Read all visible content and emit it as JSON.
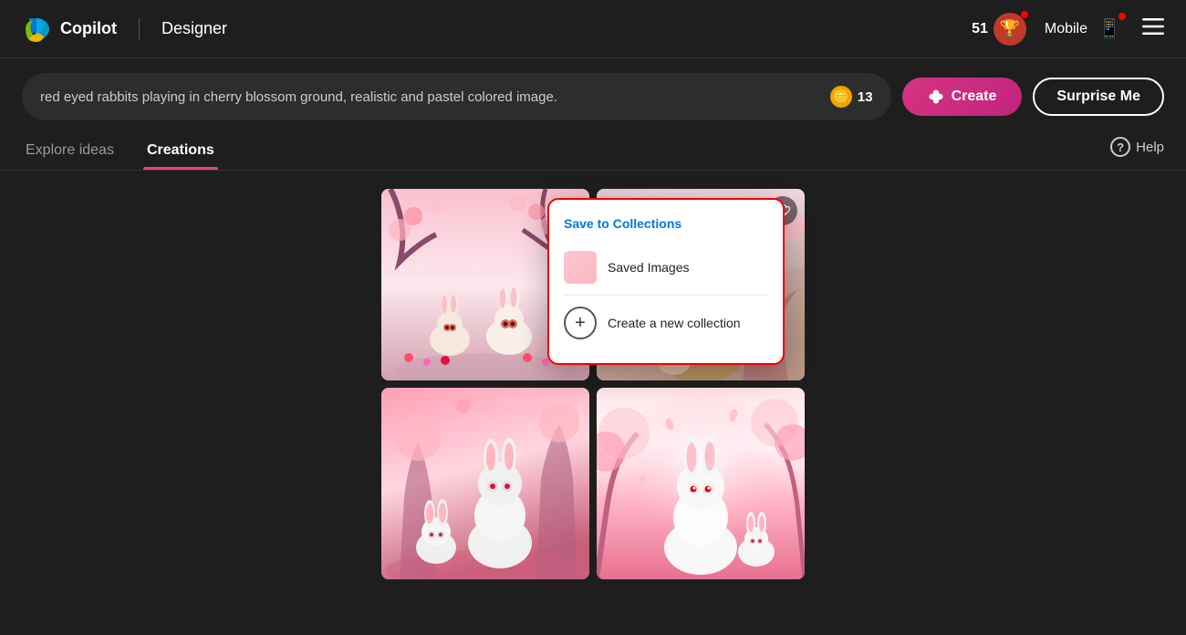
{
  "header": {
    "logo_text": "Copilot",
    "divider": "|",
    "app_name": "Designer",
    "coins": "51",
    "mobile_label": "Mobile",
    "hamburger_label": "☰"
  },
  "search": {
    "query": "red eyed rabbits playing in cherry blossom ground, realistic and pastel colored image.",
    "coin_count": "13",
    "create_label": "Create",
    "surprise_label": "Surprise Me"
  },
  "tabs": [
    {
      "id": "explore",
      "label": "Explore ideas",
      "active": false
    },
    {
      "id": "creations",
      "label": "Creations",
      "active": true
    }
  ],
  "help": {
    "label": "Help"
  },
  "popup": {
    "title_prefix": "Save to",
    "collections_link": "Collections",
    "saved_images_label": "Saved Images",
    "new_collection_label": "Create a new collection"
  },
  "images": [
    {
      "id": "img1",
      "alt": "Two rabbits in cherry blossom"
    },
    {
      "id": "img2",
      "alt": "Brown rabbit sitting up in cherry blossom"
    },
    {
      "id": "img3",
      "alt": "White rabbits with red eyes in pink garden"
    },
    {
      "id": "img4",
      "alt": "White rabbit in glowing cherry blossom scene"
    }
  ]
}
